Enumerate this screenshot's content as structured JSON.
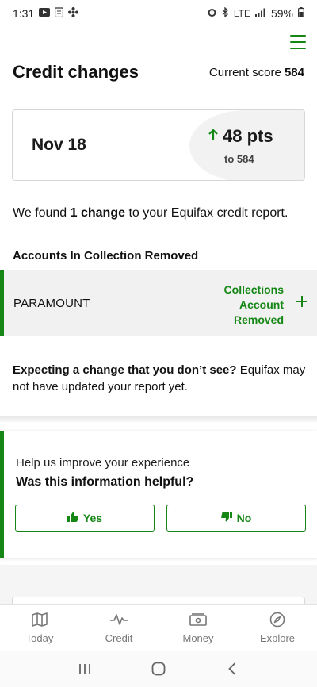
{
  "status_bar": {
    "time": "1:31",
    "network": "LTE",
    "battery": "59%"
  },
  "header": {
    "title": "Credit changes",
    "score_label": "Current score",
    "score_value": "584"
  },
  "change_card": {
    "date": "Nov 18",
    "points": "48 pts",
    "to_score": "to 584"
  },
  "summary": {
    "prefix": "We found ",
    "count": "1 change",
    "suffix": " to your Equifax credit report."
  },
  "section": {
    "heading": "Accounts In Collection Removed"
  },
  "account": {
    "name": "PARAMOUNT",
    "status": "Collections Account Removed"
  },
  "expect": {
    "bold": "Expecting a change that you don’t see?",
    "rest": " Equifax may not have updated your report yet."
  },
  "feedback": {
    "prompt": "Help us improve your experience",
    "question": "Was this information helpful?",
    "yes_label": "Yes",
    "no_label": "No"
  },
  "bottom_nav": {
    "items": [
      {
        "label": "Today",
        "icon": "map-icon"
      },
      {
        "label": "Credit",
        "icon": "pulse-icon"
      },
      {
        "label": "Money",
        "icon": "money-icon"
      },
      {
        "label": "Explore",
        "icon": "compass-icon"
      }
    ]
  },
  "colors": {
    "accent": "#168716",
    "muted": "#777777"
  }
}
